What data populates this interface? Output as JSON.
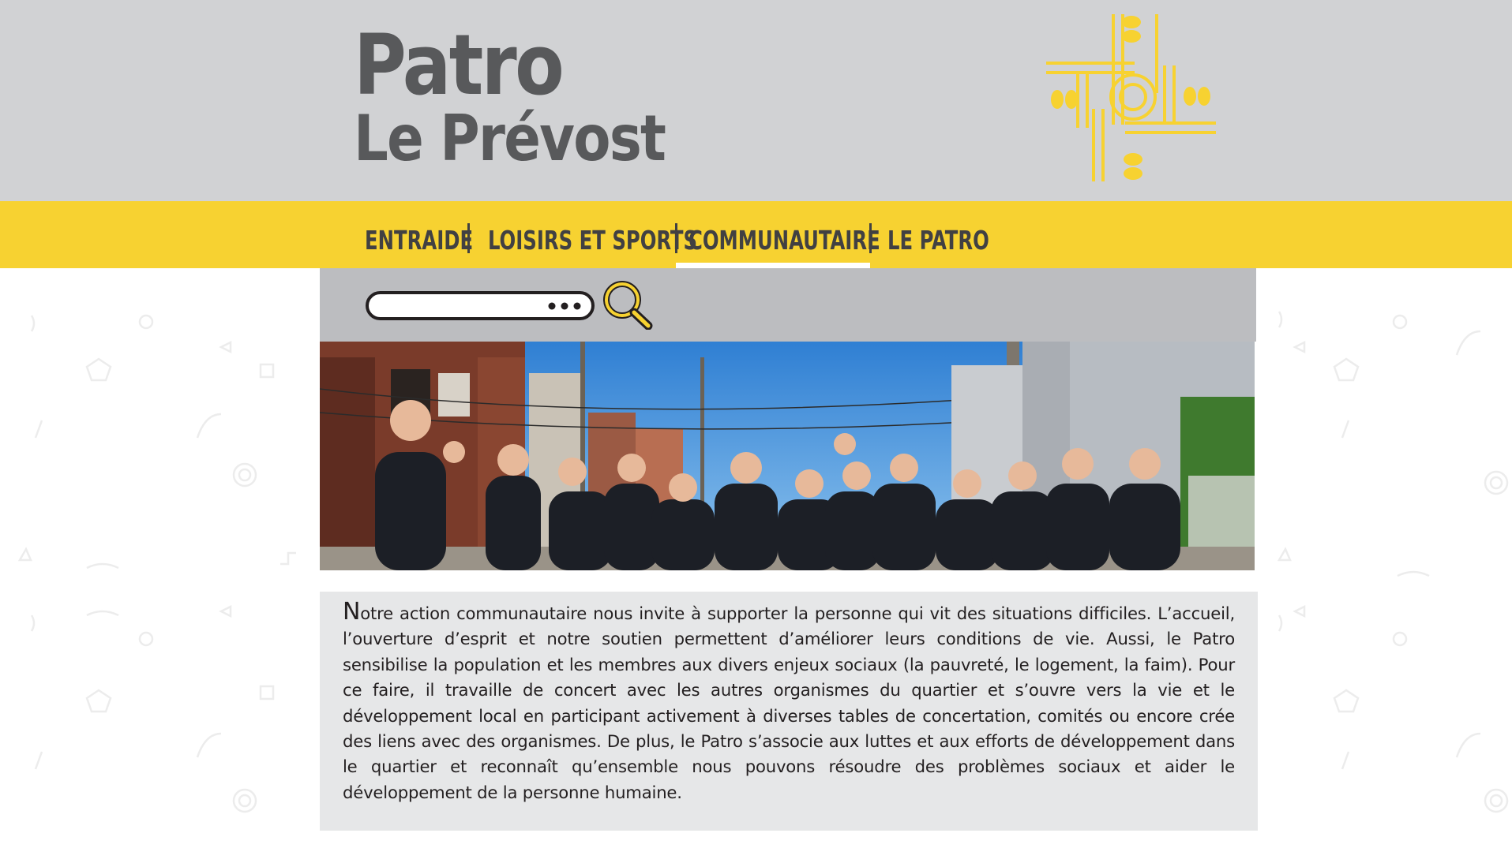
{
  "brand": {
    "line1": "Patro",
    "line2": "Le Prévost",
    "logo_icon": "patro-emblem-icon"
  },
  "nav": {
    "items": [
      {
        "label": "ENTRAIDE",
        "active": false
      },
      {
        "label": "LOISIRS ET SPORTS",
        "active": false
      },
      {
        "label": "COMMUNAUTAIRE",
        "active": true
      },
      {
        "label": "LE PATRO",
        "active": false
      }
    ]
  },
  "search": {
    "value": "",
    "placeholder": "",
    "dots_icon": "ellipsis-icon",
    "button_icon": "search-icon"
  },
  "hero": {
    "image": "community-group-photo"
  },
  "content": {
    "paragraph": "Notre action communautaire nous invite à supporter la personne qui vit des situations difficiles. L’accueil, l’ouverture d’esprit et notre soutien permettent d’améliorer leurs conditions de vie. Aussi, le Patro sensibilise la population et les membres aux divers enjeux sociaux (la pauvreté, le logement, la faim). Pour ce faire, il travaille de concert avec les autres organismes du quartier et s’ouvre vers la vie et le développement local en participant activement à diverses tables de concertation, comités ou encore crée des liens avec des organismes. De plus, le Patro s’associe aux luttes et aux efforts de développement dans le quartier et reconnaît qu’ensemble nous pouvons résoudre des problèmes sociaux et aider le développement de la personne humaine."
  },
  "colors": {
    "header_bg": "#d1d2d4",
    "accent_yellow": "#f7d231",
    "brand_gray": "#58595b",
    "search_panel": "#bcbdc0",
    "text_box": "#e6e7e8"
  }
}
